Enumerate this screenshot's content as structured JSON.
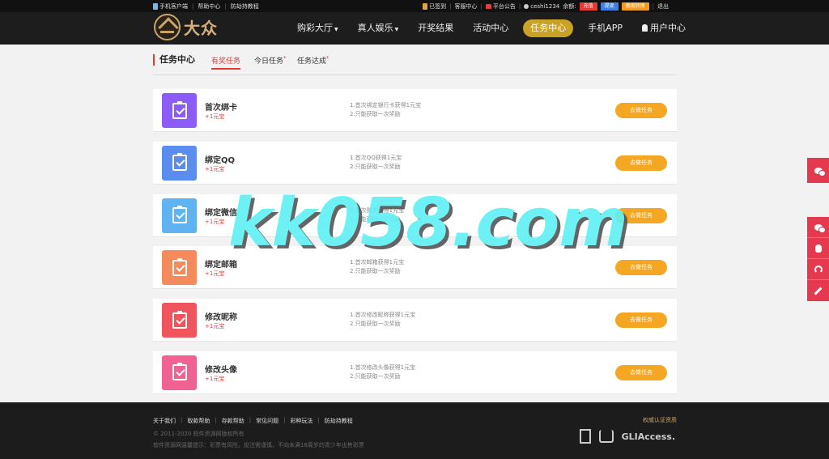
{
  "topbar": {
    "mobile_client": "手机客户端",
    "help_center": "帮助中心",
    "anti_hijack": "防劫持教程",
    "checked_in": "已签到",
    "service_center": "客服中心",
    "announcement": "平台公告",
    "username": "ceshi1234",
    "balance_label": "余额:",
    "deposit": "充值",
    "withdraw": "提现",
    "fund_detail": "额度转换",
    "logout": "退出"
  },
  "nav": {
    "logo_text": "大众",
    "items": [
      {
        "label": "购彩大厅"
      },
      {
        "label": "真人娱乐"
      },
      {
        "label": "开奖结果"
      },
      {
        "label": "活动中心"
      },
      {
        "label": "任务中心"
      },
      {
        "label": "手机APP"
      },
      {
        "label": "用户中心"
      }
    ]
  },
  "page": {
    "title": "任务中心",
    "tabs": [
      {
        "label": "有奖任务"
      },
      {
        "label": "今日任务"
      },
      {
        "label": "任务达成"
      }
    ]
  },
  "tasks": [
    {
      "name": "首次绑卡",
      "reward": "+1元宝",
      "desc1": "1.首次绑定银行卡获得1元宝",
      "desc2": "2.只能获取一次奖励",
      "button": "去做任务",
      "color": "#8b5cf6"
    },
    {
      "name": "绑定QQ",
      "reward": "+1元宝",
      "desc1": "1.首次QQ获得1元宝",
      "desc2": "2.只能获取一次奖励",
      "button": "去做任务",
      "color": "#5b8def"
    },
    {
      "name": "绑定微信",
      "reward": "+1元宝",
      "desc1": "1.首次微信获得1元宝",
      "desc2": "2.只能获取一次奖励",
      "button": "去做任务",
      "color": "#5fb3f0"
    },
    {
      "name": "绑定邮箱",
      "reward": "+1元宝",
      "desc1": "1.首次邮箱获得1元宝",
      "desc2": "2.只能获取一次奖励",
      "button": "去做任务",
      "color": "#f58a5c"
    },
    {
      "name": "修改昵称",
      "reward": "+1元宝",
      "desc1": "1.首次修改昵称获得1元宝",
      "desc2": "2.只能获取一次奖励",
      "button": "去做任务",
      "color": "#f0555e"
    },
    {
      "name": "修改头像",
      "reward": "+1元宝",
      "desc1": "1.首次修改头像获得1元宝",
      "desc2": "2.只能获取一次奖励",
      "button": "去做任务",
      "color": "#f06292"
    }
  ],
  "watermark": "kk058.com",
  "footer": {
    "links": [
      {
        "label": "关于我们"
      },
      {
        "label": "取款帮助"
      },
      {
        "label": "存款帮助"
      },
      {
        "label": "常见问题"
      },
      {
        "label": "彩种玩法"
      },
      {
        "label": "防劫持教程"
      }
    ],
    "copyright": "© 2011-2020 软件资源网版权所有",
    "notice": "软件资源网温馨提示：彩票有风险，投注需谨慎，不向未满18周岁的青少年出售彩票",
    "auth_title": "权威认证资质",
    "badge_text": "GLIAccess."
  }
}
